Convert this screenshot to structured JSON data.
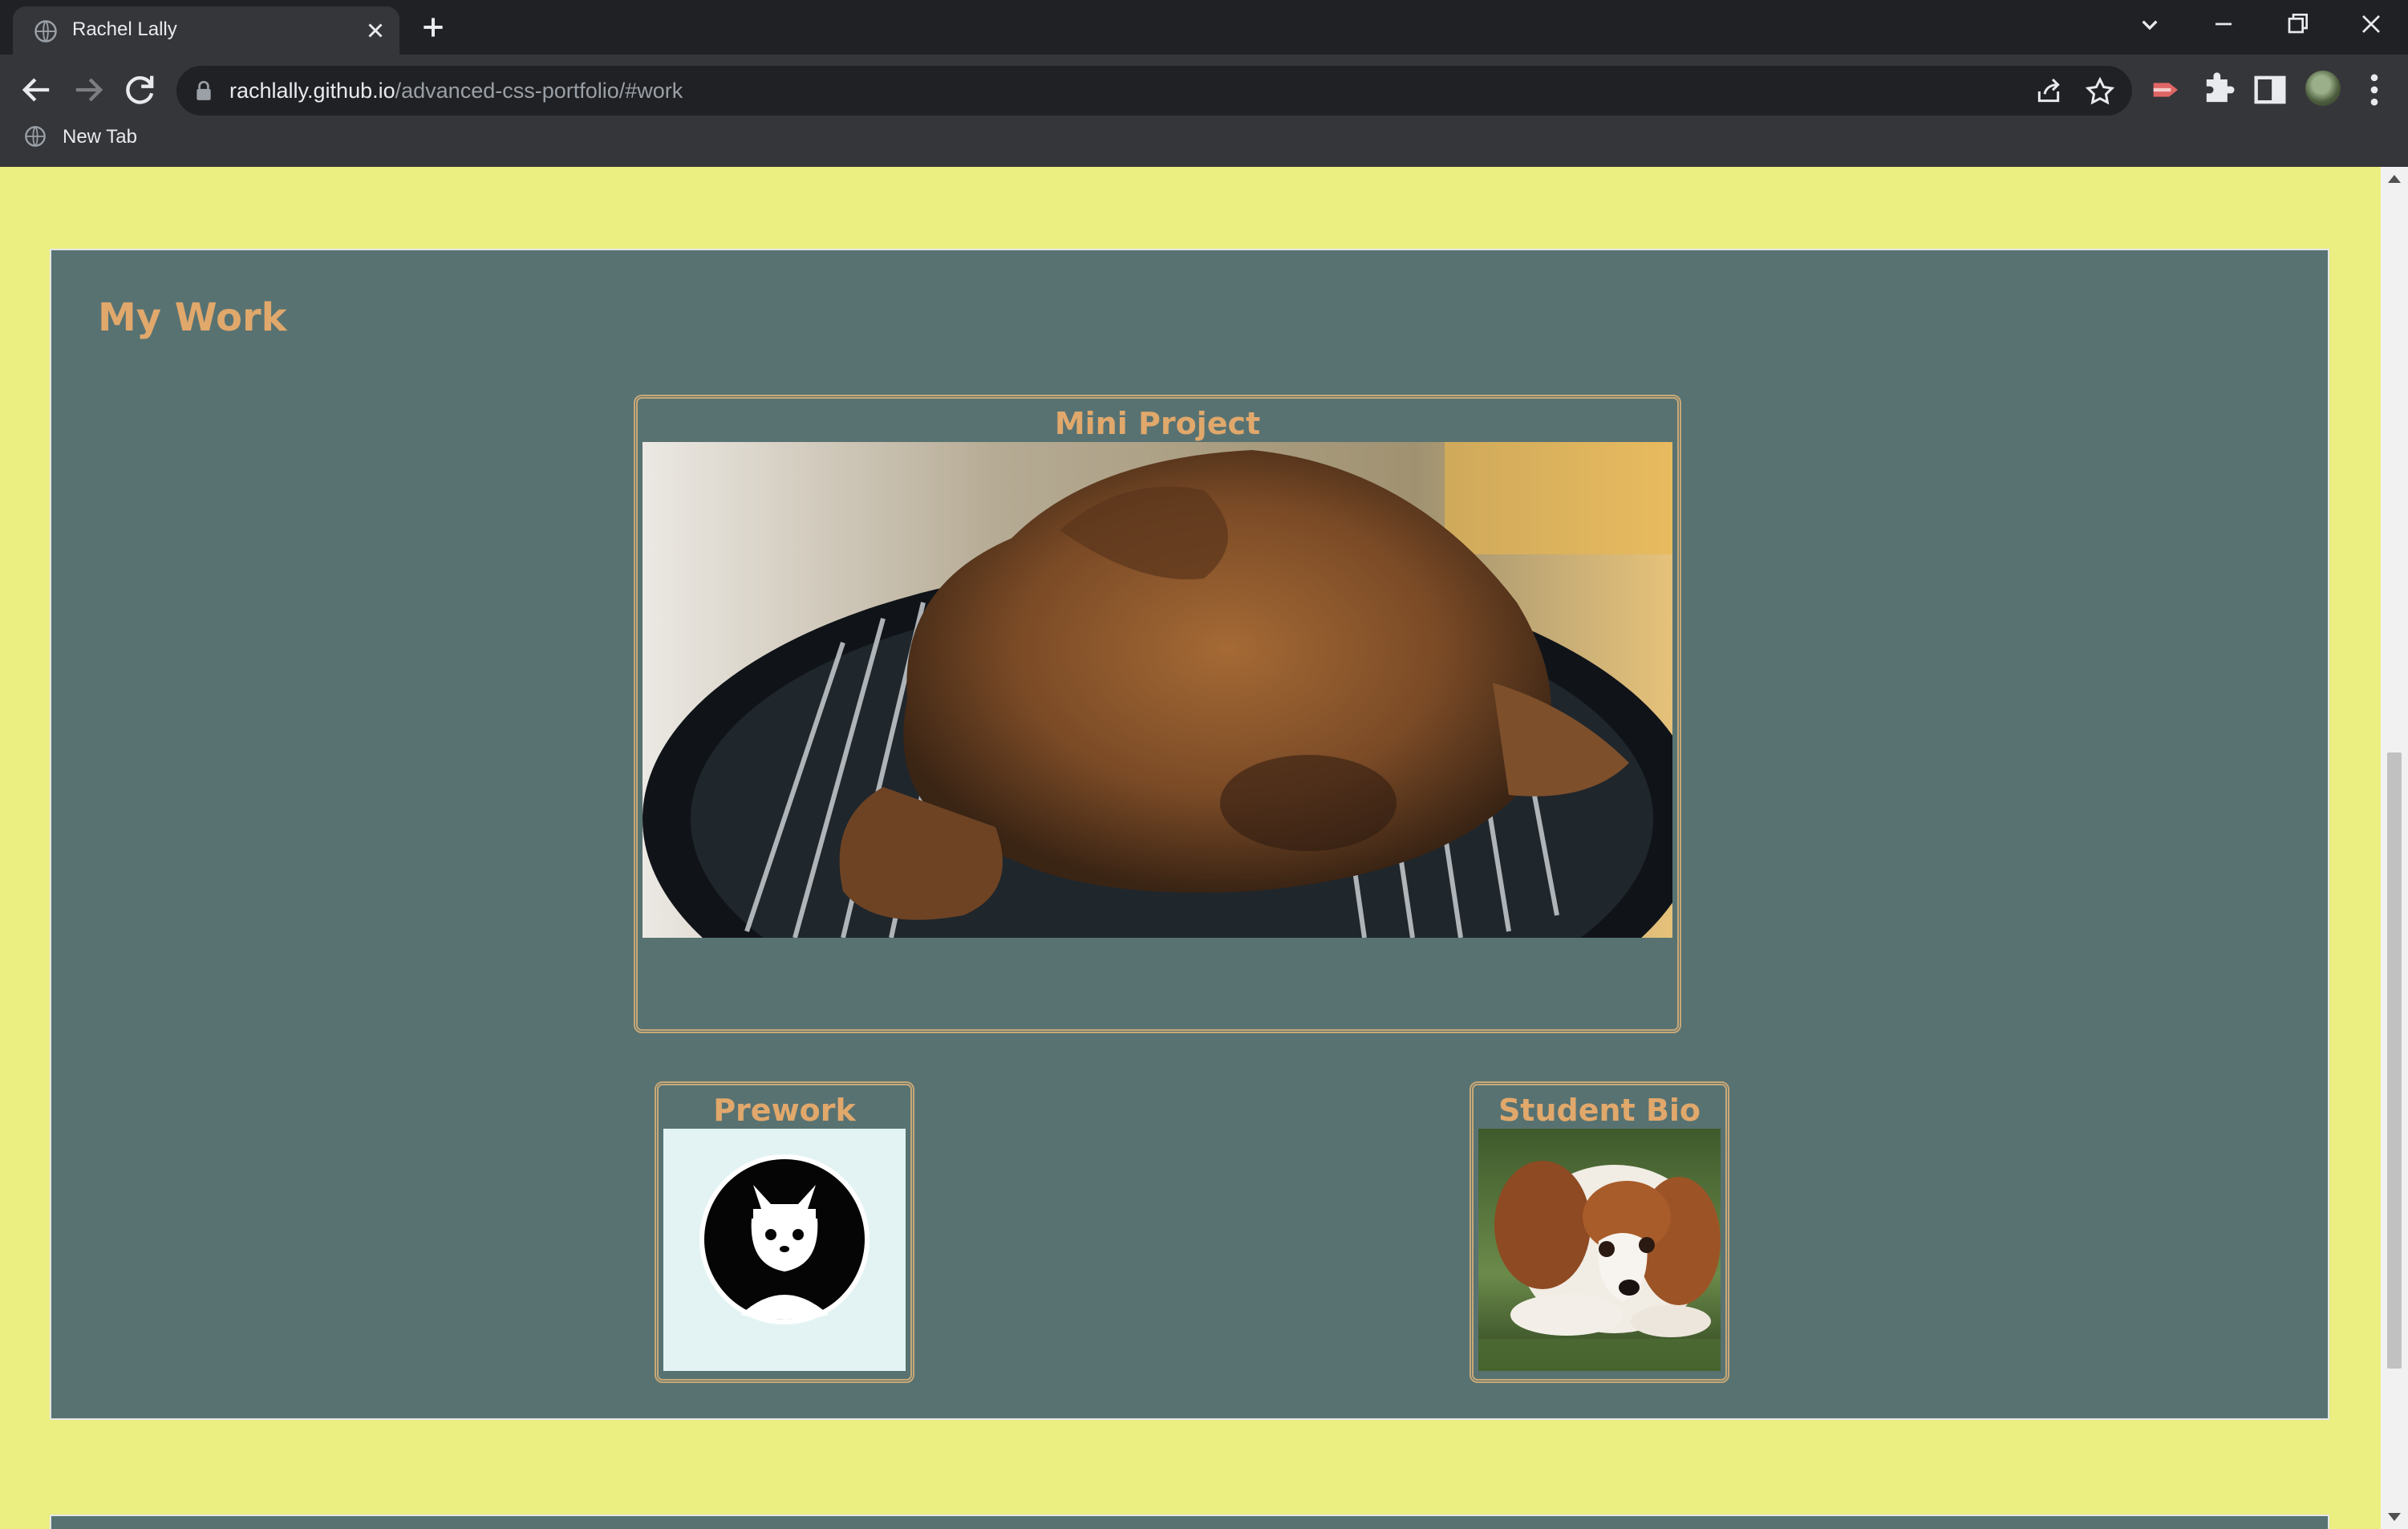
{
  "browser": {
    "tab_title": "Rachel Lally",
    "url_host": "rachlally.github.io",
    "url_path": "/advanced-css-portfolio/#work",
    "bookmark_label": "New Tab"
  },
  "colors": {
    "page_background": "#ebee80",
    "section_background": "#587272",
    "heading": "#e1a86b",
    "card_border": "#c8a876"
  },
  "section": {
    "title": "My Work",
    "projects": [
      {
        "title": "Mini Project",
        "image": "smoked turkey on grill"
      },
      {
        "title": "Prework",
        "image": "cat with bow tie logo"
      },
      {
        "title": "Student Bio",
        "image": "puppy lying on grass"
      }
    ]
  }
}
